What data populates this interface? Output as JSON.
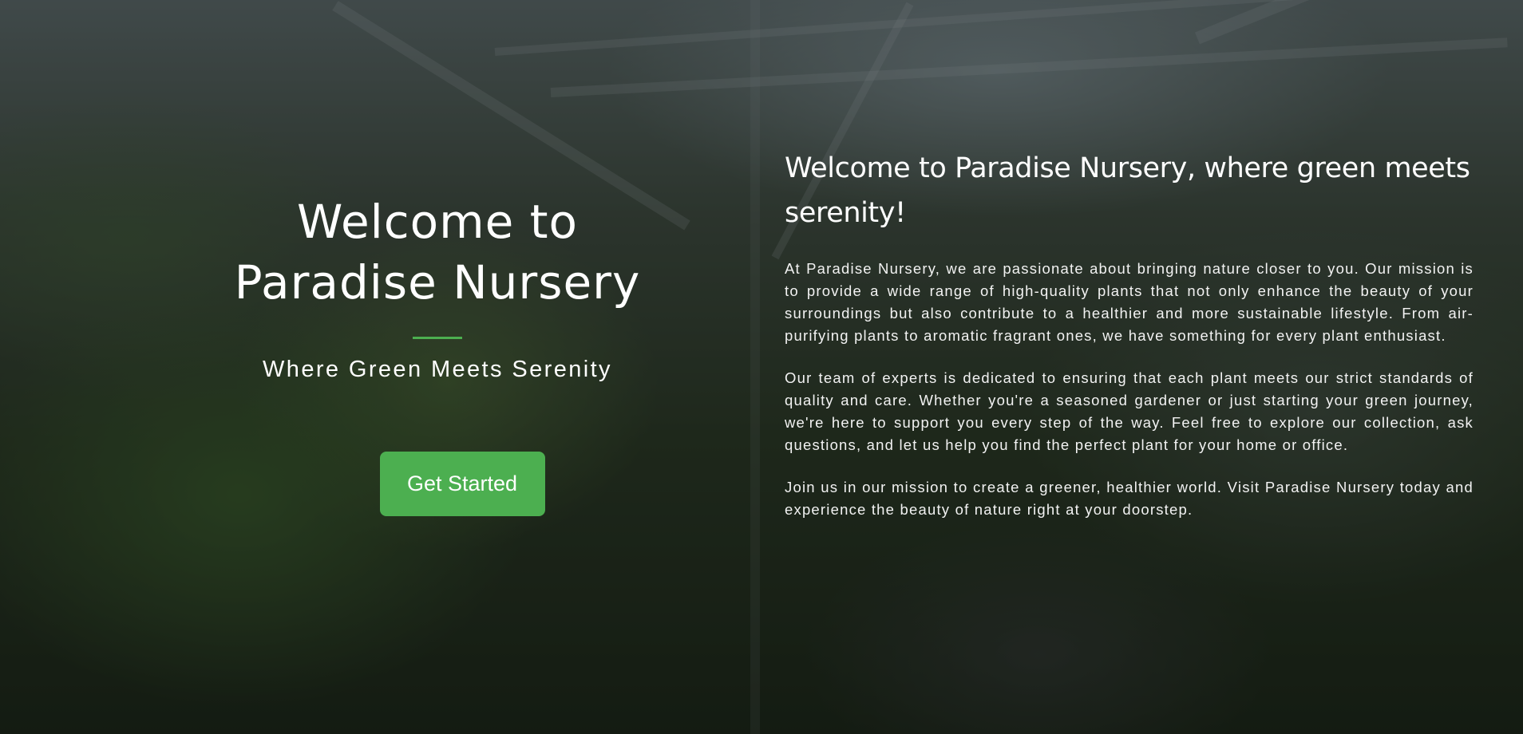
{
  "hero": {
    "title_line1": "Welcome to",
    "title_line2": "Paradise Nursery",
    "tagline": "Where Green Meets Serenity",
    "cta_label": "Get Started"
  },
  "about": {
    "heading": "Welcome to Paradise Nursery, where green meets serenity!",
    "paragraphs": [
      "At Paradise Nursery, we are passionate about bringing nature closer to you. Our mission is to provide a wide range of high-quality plants that not only enhance the beauty of your surroundings but also contribute to a healthier and more sustainable lifestyle. From air-purifying plants to aromatic fragrant ones, we have something for every plant enthusiast.",
      "Our team of experts is dedicated to ensuring that each plant meets our strict standards of quality and care. Whether you're a seasoned gardener or just starting your green journey, we're here to support you every step of the way. Feel free to explore our collection, ask questions, and let us help you find the perfect plant for your home or office.",
      "Join us in our mission to create a greener, healthier world. Visit Paradise Nursery today and experience the beauty of nature right at your doorstep."
    ]
  },
  "colors": {
    "accent": "#4caf50",
    "overlay": "rgba(0,0,0,0.42)",
    "text": "#ffffff"
  }
}
